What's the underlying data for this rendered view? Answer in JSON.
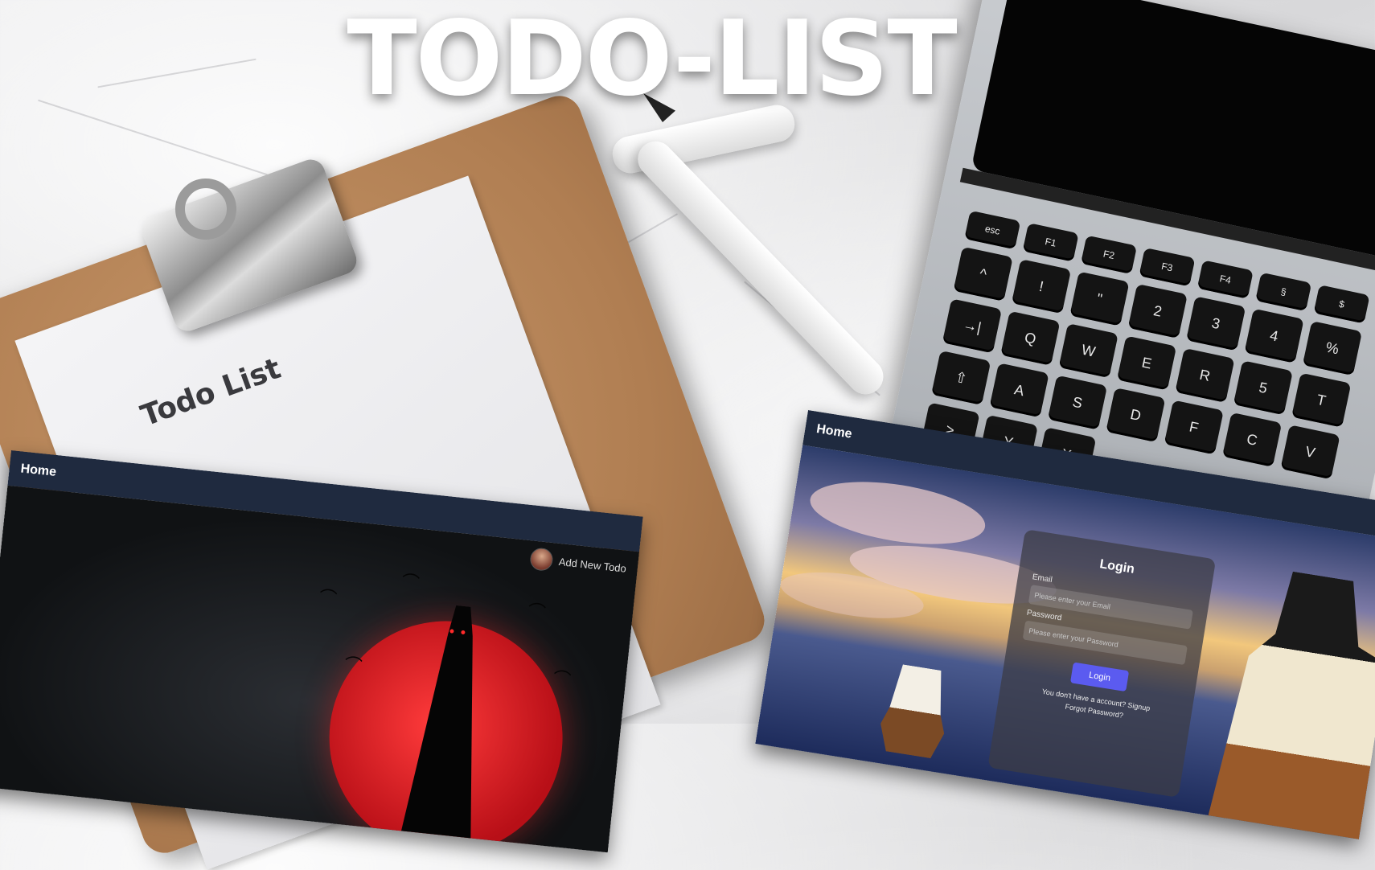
{
  "title": "TODO-LIST",
  "paper": {
    "title": "Todo List"
  },
  "keyboard": {
    "keys": [
      "esc",
      "F1",
      "F2",
      "F3",
      "F4",
      "§",
      "$",
      "^",
      "!",
      "\"",
      "2",
      "3",
      "4",
      "%",
      "→|",
      "Q",
      "W",
      "E",
      "R",
      "5",
      "T",
      "⇧",
      "A",
      "S",
      "D",
      "F",
      "C",
      "V",
      ">",
      "Y",
      "X"
    ]
  },
  "left_screenshot": {
    "nav": {
      "home_label": "Home"
    },
    "actions": {
      "add_label": "Add New Todo"
    }
  },
  "right_screenshot": {
    "nav": {
      "home_label": "Home"
    },
    "login": {
      "title": "Login",
      "email_label": "Email",
      "email_placeholder": "Please enter your Email",
      "password_label": "Password",
      "password_placeholder": "Please enter your Password",
      "button_label": "Login",
      "signup_text": "You don't have a account? Signup",
      "forgot_text": "Forgot Password?"
    }
  },
  "colors": {
    "navbar": "#1f2a3f",
    "login_button": "#5b5bf0",
    "moon": "#d11a22"
  }
}
